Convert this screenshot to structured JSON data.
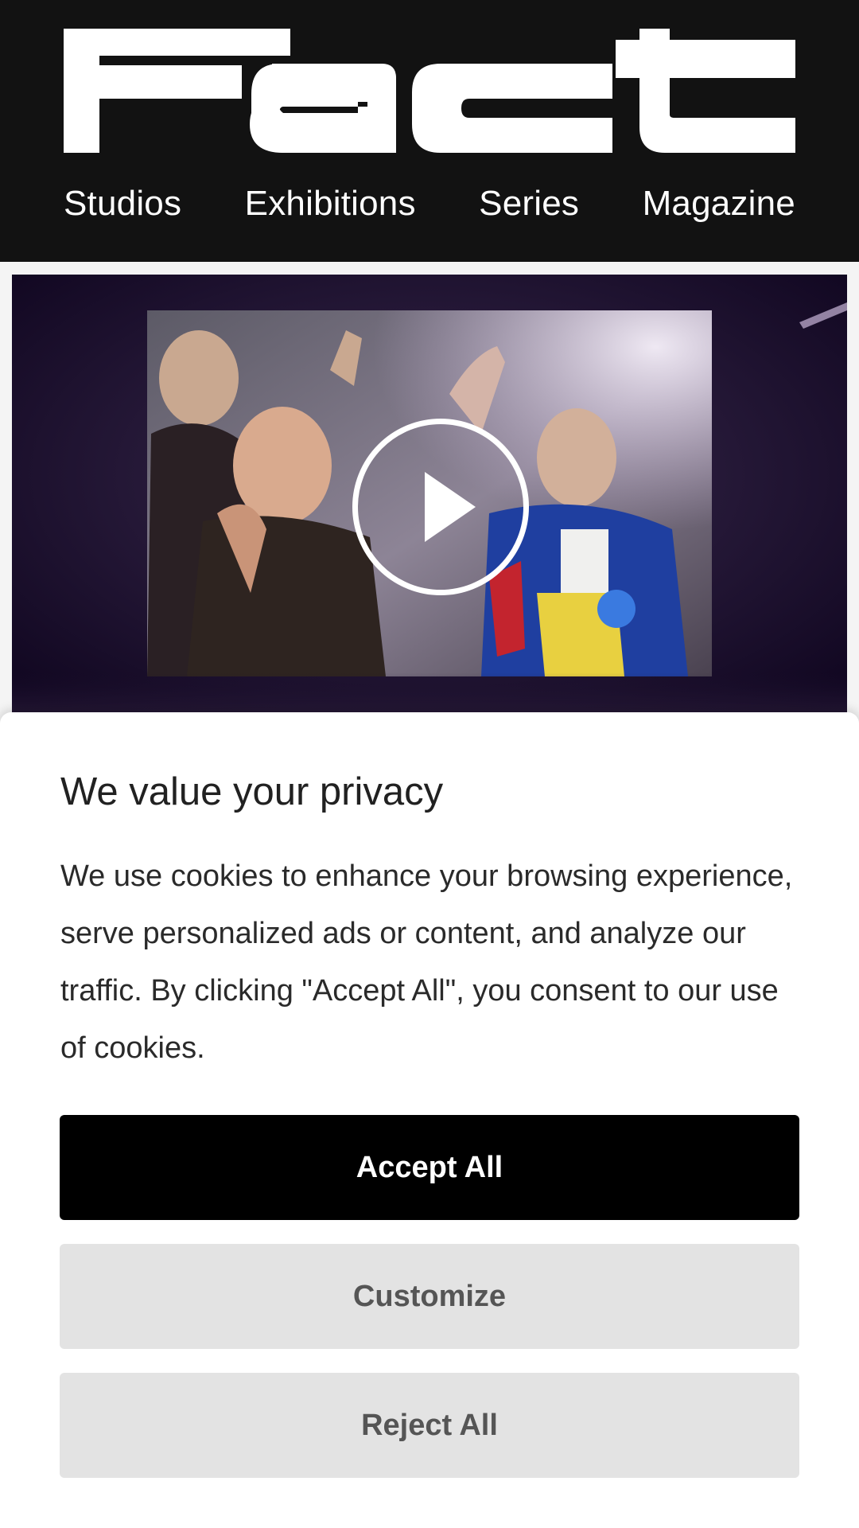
{
  "brand": {
    "logo_text": "Fact"
  },
  "nav": {
    "items": [
      {
        "label": "Studios"
      },
      {
        "label": "Exhibitions"
      },
      {
        "label": "Series"
      },
      {
        "label": "Magazine"
      }
    ]
  },
  "hero": {
    "play_icon": "play-icon"
  },
  "cookie": {
    "title": "We value your privacy",
    "body": "We use cookies to enhance your browsing experience, serve personalized ads or content, and analyze our traffic. By clicking \"Accept All\", you consent to our use of cookies.",
    "accept_label": "Accept All",
    "customize_label": "Customize",
    "reject_label": "Reject All"
  },
  "colors": {
    "header_bg": "#121212",
    "accept_bg": "#000000",
    "secondary_bg": "#e3e3e3",
    "secondary_text": "#555555"
  }
}
